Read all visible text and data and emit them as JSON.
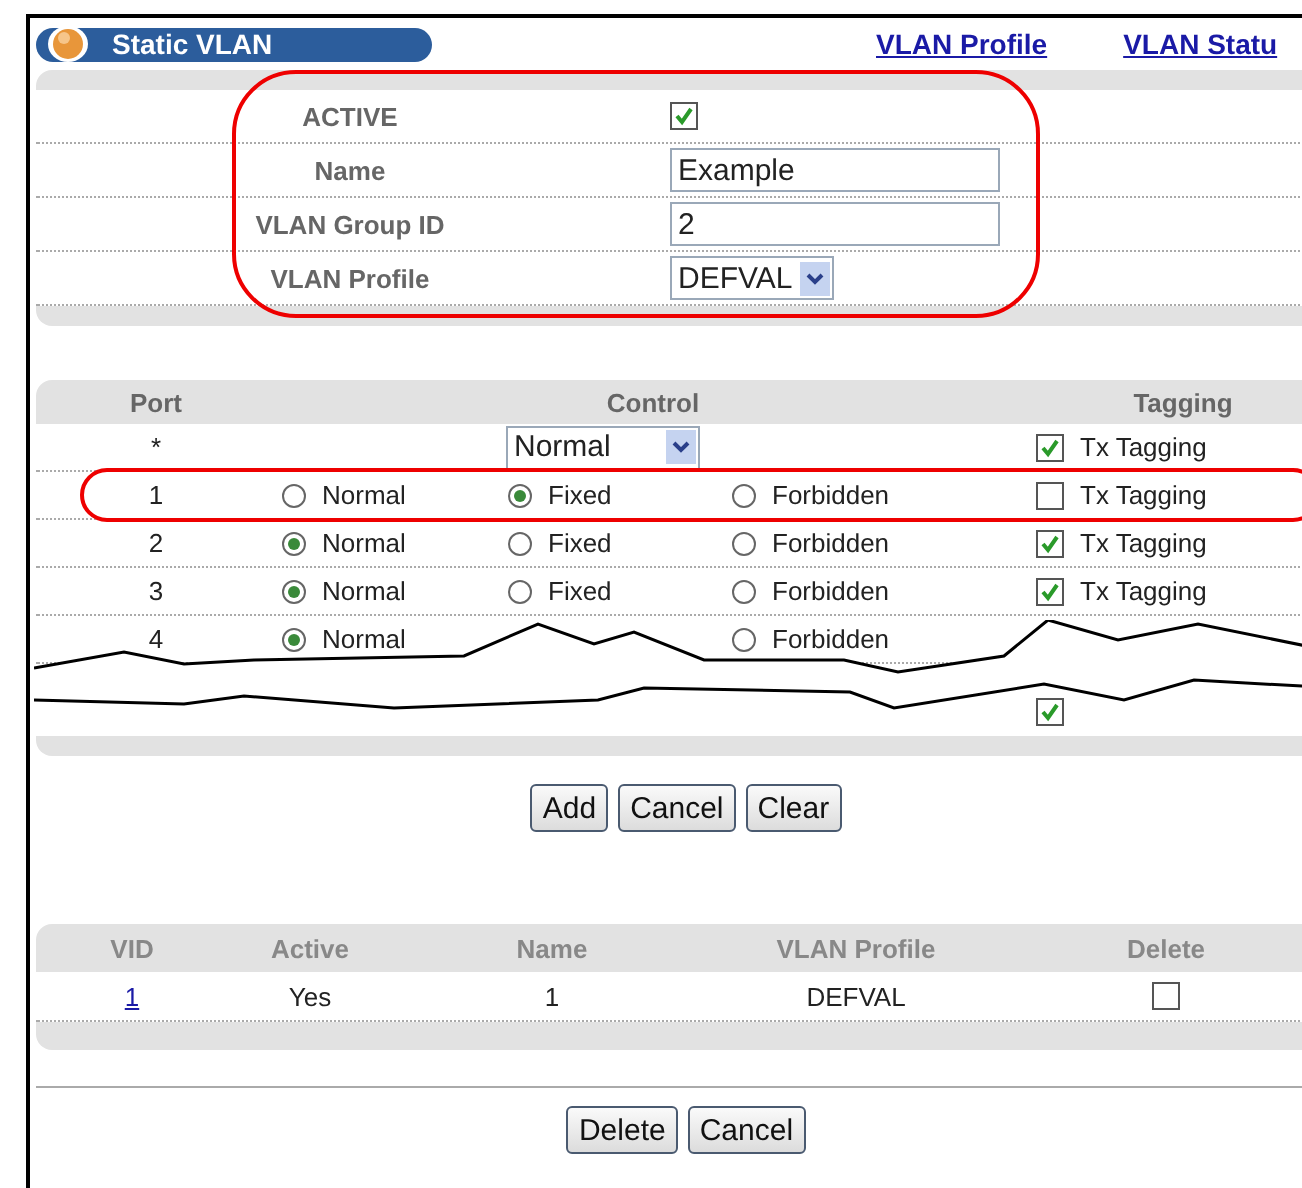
{
  "header": {
    "title": "Static VLAN",
    "links": [
      "VLAN Profile",
      "VLAN Statu"
    ]
  },
  "vlan_form": {
    "callout": true,
    "active": {
      "label": "ACTIVE",
      "checked": true
    },
    "name": {
      "label": "Name",
      "value": "Example"
    },
    "group_id": {
      "label": "VLAN Group ID",
      "value": "2"
    },
    "profile": {
      "label": "VLAN Profile",
      "value": "DEFVAL"
    }
  },
  "ports": {
    "columns": [
      "Port",
      "Control",
      "Tagging"
    ],
    "rows": [
      {
        "kind": "all",
        "port": "*",
        "control": "Normal",
        "tagging": {
          "label": "Tx Tagging",
          "checked": true
        }
      },
      {
        "kind": "port",
        "callout": true,
        "port": "1",
        "options": [
          {
            "label": "Normal",
            "selected": false
          },
          {
            "label": "Fixed",
            "selected": true
          },
          {
            "label": "Forbidden",
            "selected": false
          }
        ],
        "tagging": {
          "label": "Tx Tagging",
          "checked": false
        }
      },
      {
        "kind": "port",
        "port": "2",
        "options": [
          {
            "label": "Normal",
            "selected": true
          },
          {
            "label": "Fixed",
            "selected": false
          },
          {
            "label": "Forbidden",
            "selected": false
          }
        ],
        "tagging": {
          "label": "Tx Tagging",
          "checked": true
        }
      },
      {
        "kind": "port",
        "port": "3",
        "options": [
          {
            "label": "Normal",
            "selected": true
          },
          {
            "label": "Fixed",
            "selected": false
          },
          {
            "label": "Forbidden",
            "selected": false
          }
        ],
        "tagging": {
          "label": "Tx Tagging",
          "checked": true
        }
      },
      {
        "kind": "port",
        "port": "4",
        "options": [
          {
            "label": "Normal",
            "selected": true
          },
          {
            "label": "Forbidden",
            "selected": false,
            "kind": "forbidden"
          }
        ]
      },
      {
        "kind": "torn"
      },
      {
        "kind": "port",
        "tagging": {
          "checked": true
        }
      }
    ]
  },
  "port_buttons": [
    "Add",
    "Cancel",
    "Clear"
  ],
  "vlan_table": {
    "columns": [
      "VID",
      "Active",
      "Name",
      "VLAN Profile",
      "Delete"
    ],
    "rows": [
      {
        "vid": "1",
        "active": "Yes",
        "name": "1",
        "profile": "DEFVAL",
        "delete": false
      }
    ]
  },
  "bottom_buttons": [
    "Delete",
    "Cancel"
  ]
}
